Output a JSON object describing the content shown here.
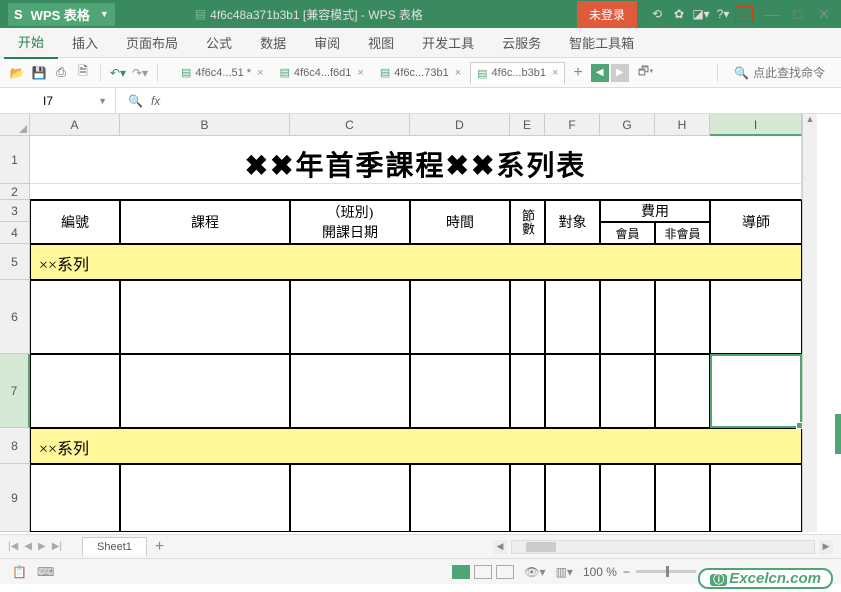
{
  "app": {
    "logo_text": "S",
    "name": "WPS 表格",
    "doc_title": "4f6c48a371b3b1 [兼容模式] - WPS 表格",
    "login": "未登录"
  },
  "menu": {
    "items": [
      "开始",
      "插入",
      "页面布局",
      "公式",
      "数据",
      "审阅",
      "视图",
      "开发工具",
      "云服务",
      "智能工具箱"
    ],
    "active": 0
  },
  "file_tabs": [
    {
      "label": "4f6c4...51 *",
      "active": false
    },
    {
      "label": "4f6c4...f6d1",
      "active": false
    },
    {
      "label": "4f6c...73b1",
      "active": false
    },
    {
      "label": "4f6c...b3b1",
      "active": true
    }
  ],
  "search": {
    "placeholder": "点此查找命令"
  },
  "formula": {
    "name_box": "I7",
    "fx": "fx"
  },
  "columns": [
    "A",
    "B",
    "C",
    "D",
    "E",
    "F",
    "G",
    "H",
    "I"
  ],
  "selected_col": "I",
  "selected_row": 7,
  "rows": [
    1,
    2,
    3,
    4,
    5,
    6,
    7,
    8,
    9
  ],
  "sheet": {
    "title": "✖✖年首季課程✖✖系列表",
    "headers": {
      "id": "編號",
      "course": "課程",
      "class": "（班別)",
      "startdate": "開課日期",
      "time": "時間",
      "sessions": "節數",
      "target": "對象",
      "fee": "費用",
      "member": "會員",
      "nonmember": "非會員",
      "instructor": "導師"
    },
    "series_label": "××系列"
  },
  "sheet_tabs": {
    "active": "Sheet1"
  },
  "status": {
    "zoom": "100 %"
  },
  "watermark": "Excelcn.com"
}
